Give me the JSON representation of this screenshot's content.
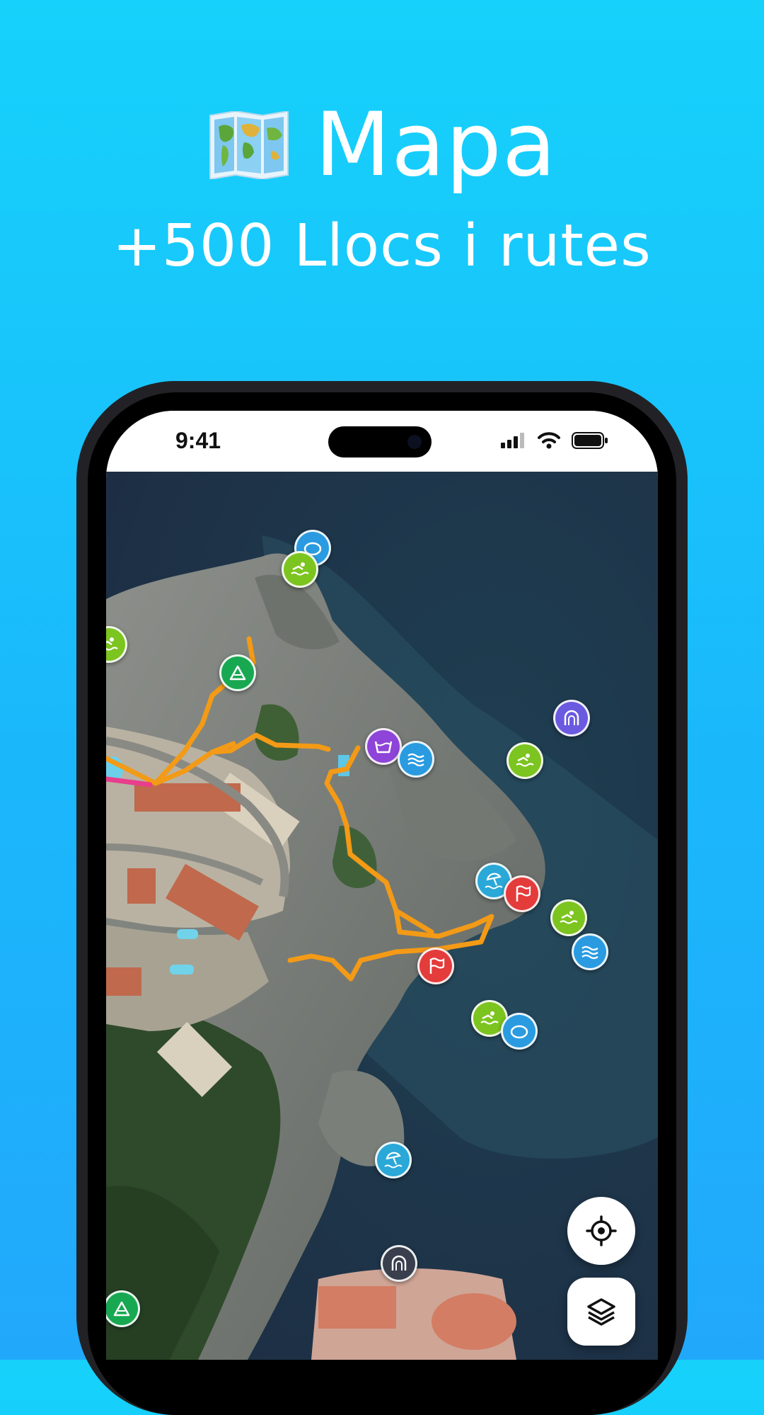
{
  "header": {
    "title": "Mapa",
    "subtitle": "+500 Llocs i rutes",
    "title_icon": "world-map-icon"
  },
  "status_bar": {
    "time": "9:41",
    "icons": [
      "cellular-signal-icon",
      "wifi-icon",
      "battery-icon"
    ]
  },
  "map": {
    "view": "satellite",
    "markers": [
      {
        "type": "cave",
        "icon": "cave-icon",
        "color": "#2a9be0"
      },
      {
        "type": "swim",
        "icon": "swim-icon",
        "color": "#7cc41f"
      },
      {
        "type": "swim",
        "icon": "swim-icon",
        "color": "#7cc41f"
      },
      {
        "type": "summit",
        "icon": "mountain-icon",
        "color": "#18a851"
      },
      {
        "type": "laundry",
        "icon": "washbasin-icon",
        "color": "#8e44d8"
      },
      {
        "type": "waves",
        "icon": "waves-icon",
        "color": "#2a9be0"
      },
      {
        "type": "tunnel",
        "icon": "arch-icon",
        "color": "#6a5ae0"
      },
      {
        "type": "swim",
        "icon": "swim-icon",
        "color": "#7cc41f"
      },
      {
        "type": "beach",
        "icon": "beach-umbrella-icon",
        "color": "#2aa8d8"
      },
      {
        "type": "flag",
        "icon": "flag-icon",
        "color": "#e43b3b"
      },
      {
        "type": "swim",
        "icon": "swim-icon",
        "color": "#7cc41f"
      },
      {
        "type": "waves",
        "icon": "waves-icon",
        "color": "#2a9be0"
      },
      {
        "type": "flag",
        "icon": "flag-icon",
        "color": "#e43b3b"
      },
      {
        "type": "swim",
        "icon": "swim-icon",
        "color": "#7cc41f"
      },
      {
        "type": "cave",
        "icon": "cave-icon",
        "color": "#2a9be0"
      },
      {
        "type": "beach",
        "icon": "beach-umbrella-icon",
        "color": "#2aa8d8"
      },
      {
        "type": "tunnel",
        "icon": "arch-icon",
        "color": "#3a3f4e"
      },
      {
        "type": "summit",
        "icon": "mountain-icon",
        "color": "#18a851"
      }
    ],
    "route_color": "#f39a16",
    "route_color_alt": "#e83e8c"
  },
  "controls": {
    "locate_icon": "crosshair-icon",
    "layers_icon": "layers-icon"
  }
}
